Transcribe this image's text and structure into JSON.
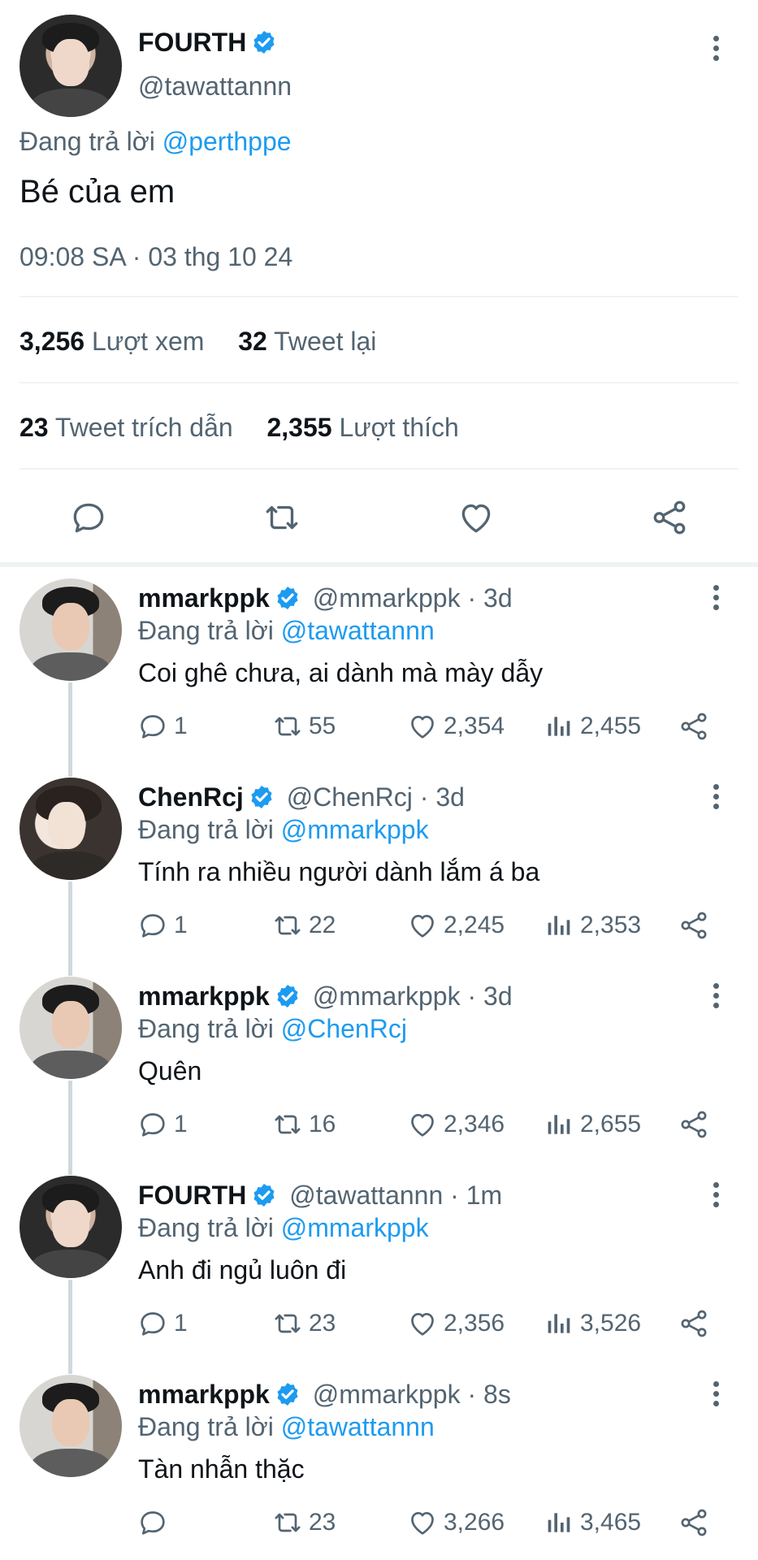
{
  "main": {
    "name": "FOURTH",
    "handle": "@tawattannn",
    "replying_prefix": "Đang trả lời",
    "replying_to": "@perthppe",
    "text": "Bé của em",
    "timestamp": "09:08 SA · 03 thg 10 24",
    "stats": {
      "views_count": "3,256",
      "views_label": "Lượt xem",
      "retweets_count": "32",
      "retweets_label": "Tweet lại",
      "quotes_count": "23",
      "quotes_label": "Tweet trích dẫn",
      "likes_count": "2,355",
      "likes_label": "Lượt thích"
    }
  },
  "replies": [
    {
      "name": "mmarkppk",
      "handle": "@mmarkppk",
      "time": "3d",
      "replying_prefix": "Đang trả lời",
      "replying_to": "@tawattannn",
      "text": "Coi ghê chưa, ai dành mà mày dẫy",
      "replies": "1",
      "retweets": "55",
      "likes": "2,354",
      "views": "2,455"
    },
    {
      "name": "ChenRcj",
      "handle": "@ChenRcj",
      "time": "3d",
      "replying_prefix": "Đang trả lời",
      "replying_to": "@mmarkppk",
      "text": "Tính ra nhiều người dành lắm á ba",
      "replies": "1",
      "retweets": "22",
      "likes": "2,245",
      "views": "2,353"
    },
    {
      "name": "mmarkppk",
      "handle": "@mmarkppk",
      "time": "3d",
      "replying_prefix": "Đang trả lời",
      "replying_to": "@ChenRcj",
      "text": "Quên",
      "replies": "1",
      "retweets": "16",
      "likes": "2,346",
      "views": "2,655"
    },
    {
      "name": "FOURTH",
      "handle": "@tawattannn",
      "time": "1m",
      "replying_prefix": "Đang trả lời",
      "replying_to": "@mmarkppk",
      "text": "Anh đi ngủ luôn đi",
      "replies": "1",
      "retweets": "23",
      "likes": "2,356",
      "views": "3,526"
    },
    {
      "name": "mmarkppk",
      "handle": "@mmarkppk",
      "time": "8s",
      "replying_prefix": "Đang trả lời",
      "replying_to": "@tawattannn",
      "text": "Tàn nhẫn thặc",
      "replies": "",
      "retweets": "23",
      "likes": "3,266",
      "views": "3,465"
    }
  ],
  "colors": {
    "link": "#1d9bf0",
    "secondary": "#536471",
    "verified": "#1d9bf0",
    "divider": "#eff3f4"
  },
  "icons": [
    "verified-badge-icon",
    "more-icon",
    "reply-icon",
    "retweet-icon",
    "like-icon",
    "views-icon",
    "share-icon"
  ]
}
